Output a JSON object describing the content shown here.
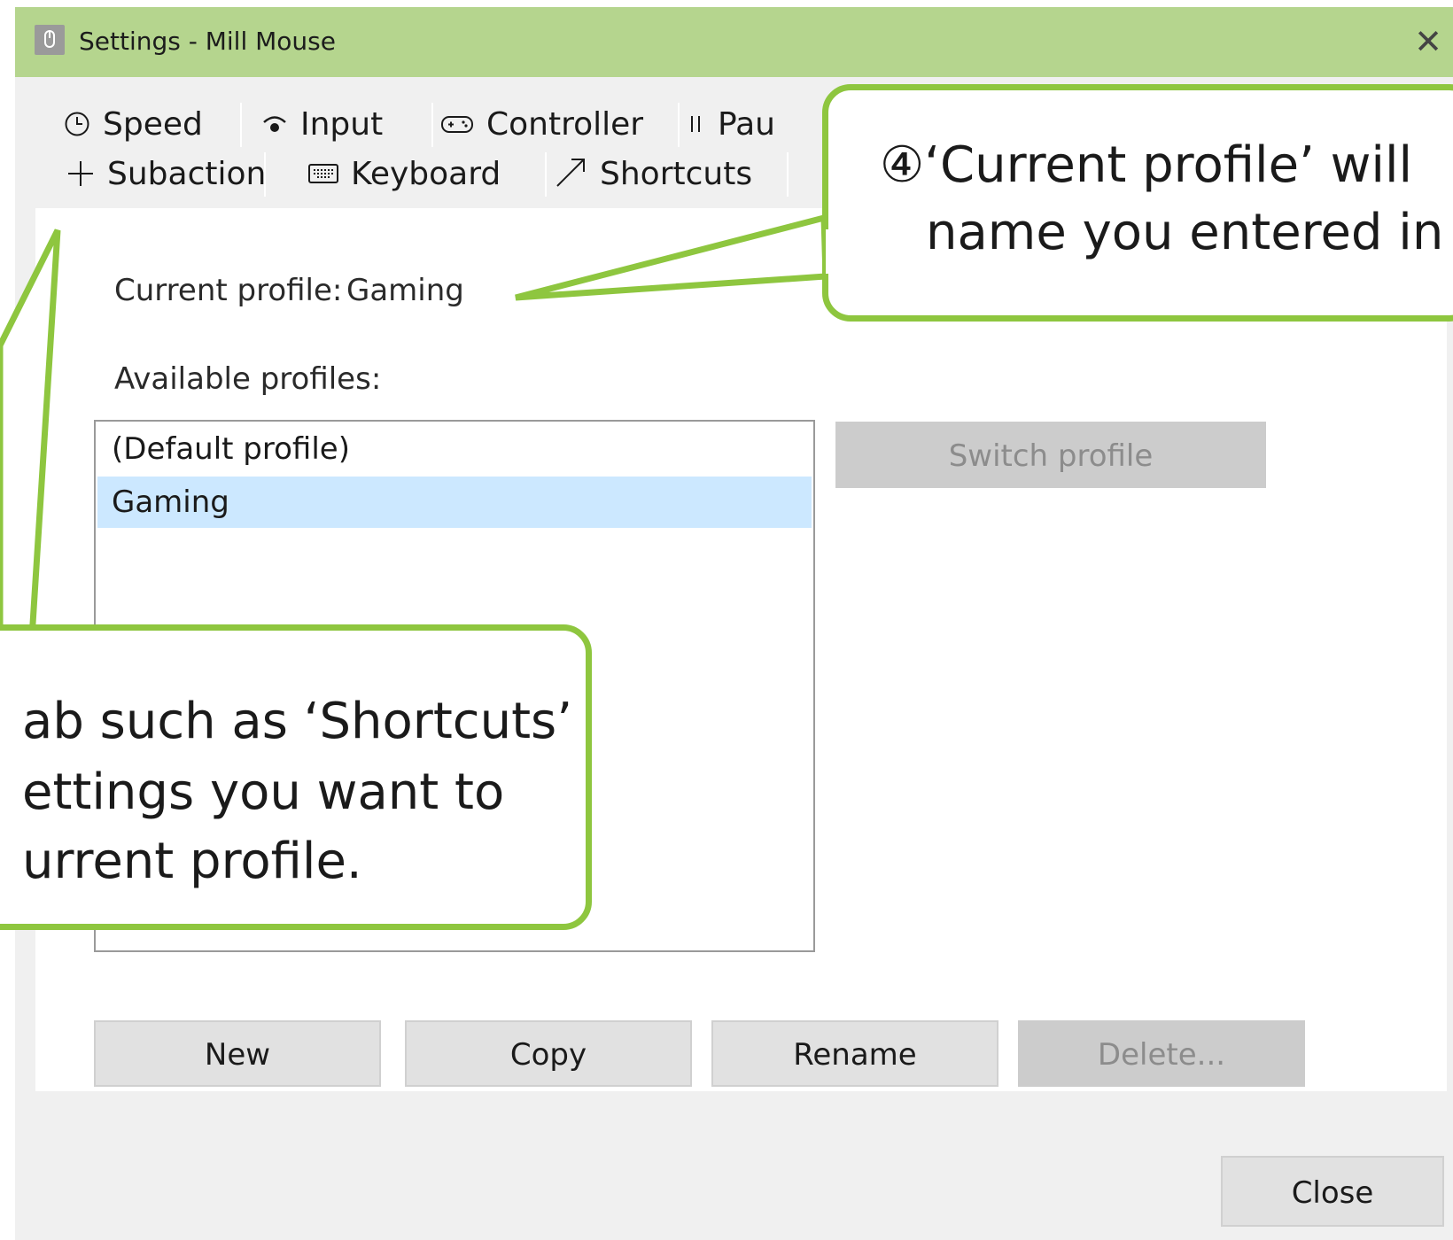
{
  "window": {
    "title": "Settings - Mill Mouse",
    "close_glyph": "✕"
  },
  "tabs": {
    "row1": [
      {
        "icon": "clock-icon",
        "glyph": "🕒",
        "label": "Speed"
      },
      {
        "icon": "wifi-icon",
        "glyph": "◓",
        "label": "Input"
      },
      {
        "icon": "gamepad-icon",
        "glyph": "🎮",
        "label": "Controller"
      },
      {
        "icon": "pause-icon",
        "glyph": "||",
        "label": "Pau"
      }
    ],
    "row2": [
      {
        "icon": "plus-icon",
        "glyph": "+",
        "label": "Subaction"
      },
      {
        "icon": "keyboard-icon",
        "glyph": "⌨",
        "label": "Keyboard"
      },
      {
        "icon": "arrow-icon",
        "glyph": "↗",
        "label": "Shortcuts"
      }
    ]
  },
  "profile": {
    "current_label": "Current profile:",
    "current_value": "Gaming",
    "available_label": "Available profiles:",
    "items": [
      "(Default profile)",
      "Gaming"
    ],
    "selected_index": 1
  },
  "buttons": {
    "switch": "Switch profile",
    "new": "New",
    "copy": "Copy",
    "rename": "Rename",
    "delete": "Delete...",
    "close": "Close"
  },
  "callouts": {
    "top": {
      "line1": "④‘Current profile’ will",
      "line2": "name you entered in"
    },
    "bottom": {
      "line1": "ab such as ‘Shortcuts’",
      "line2": "ettings you want to",
      "line3": "urrent profile."
    }
  },
  "colors": {
    "titlebar": "#b5d58e",
    "callout_border": "#8ec63f",
    "selection": "#cce8ff"
  }
}
